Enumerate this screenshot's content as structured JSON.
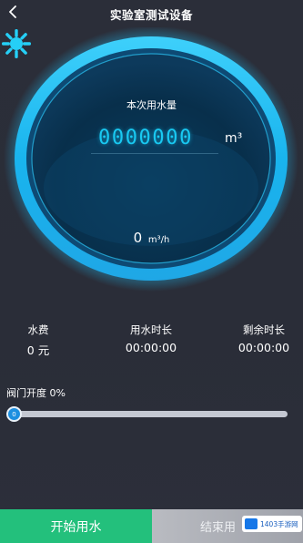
{
  "header": {
    "title": "实验室测试设备",
    "back_icon": "chevron-left-icon"
  },
  "gauge": {
    "label": "本次用水量",
    "reading": "0000000",
    "unit": "m³",
    "activity_icon": "spinner-icon",
    "flow_value": "0",
    "flow_unit": "m³/h",
    "accent_color": "#19c9f2",
    "ring_color": "#1fb8ee"
  },
  "stats": {
    "fee_label": "水费",
    "fee_value": "0 元",
    "used_label": "用水时长",
    "used_value": "00:00:00",
    "left_label": "剩余时长",
    "left_value": "00:00:00"
  },
  "valve": {
    "label": "阀门开度 0%",
    "thumb_text": "0",
    "level_percent": 0
  },
  "footer": {
    "start_label": "开始用水",
    "end_label": "结束用",
    "start_color": "#23c07c",
    "end_color": "#b0b3b9"
  },
  "watermark": {
    "text": "1403手游网"
  }
}
